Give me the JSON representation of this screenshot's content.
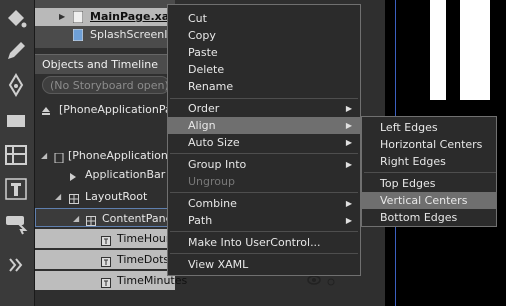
{
  "project_files": [
    {
      "label": "MainPage.xaml",
      "selected": true
    },
    {
      "label": "SplashScreenIm",
      "selected": false
    }
  ],
  "panel": {
    "title": "Objects and Timeline",
    "storyboard": "(No Storyboard open)"
  },
  "tree": [
    {
      "label": "[PhoneApplicationPa"
    },
    {
      "label": "[PhoneApplicationP"
    },
    {
      "label": "ApplicationBar"
    },
    {
      "label": "LayoutRoot"
    },
    {
      "label": "ContentPane"
    },
    {
      "label": "TimeHour"
    },
    {
      "label": "TimeDots"
    },
    {
      "label": "TimeMinutes"
    }
  ],
  "context_menu": {
    "items": [
      {
        "label": "Cut"
      },
      {
        "label": "Copy"
      },
      {
        "label": "Paste"
      },
      {
        "label": "Delete"
      },
      {
        "label": "Rename"
      },
      {
        "label": "Order"
      },
      {
        "label": "Align"
      },
      {
        "label": "Auto Size"
      },
      {
        "label": "Group Into"
      },
      {
        "label": "Ungroup"
      },
      {
        "label": "Combine"
      },
      {
        "label": "Path"
      },
      {
        "label": "Make Into UserControl..."
      },
      {
        "label": "View XAML"
      }
    ]
  },
  "align_submenu": {
    "items": [
      {
        "label": "Left Edges"
      },
      {
        "label": "Horizontal Centers"
      },
      {
        "label": "Right Edges"
      },
      {
        "label": "Top Edges"
      },
      {
        "label": "Vertical Centers"
      },
      {
        "label": "Bottom Edges"
      }
    ]
  },
  "icons": {
    "expand_more_icon": "double-chevron-right-icon"
  },
  "colors": {
    "menu_highlight": "#6f6f6f",
    "selection_border": "#5f7fae",
    "canvas_guide": "#3b5fbf"
  }
}
